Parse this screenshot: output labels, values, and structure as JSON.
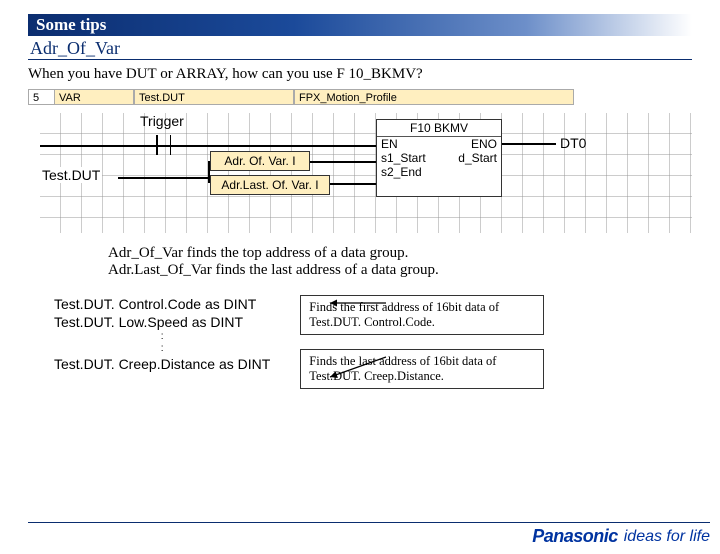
{
  "header": {
    "title": "Some tips",
    "subtitle": "Adr_Of_Var"
  },
  "question": "When you have DUT or ARRAY, how can you use F 10_BKMV?",
  "varrow": {
    "num": "5",
    "class": "VAR",
    "name": "Test.DUT",
    "type": "FPX_Motion_Profile"
  },
  "diagram": {
    "trigger": "Trigger",
    "testdut": "Test.DUT",
    "adr_of_var": "Adr. Of. Var. I",
    "adr_last": "Adr.Last. Of. Var. I",
    "f10_title": "F10 BKMV",
    "en": "EN",
    "eno": "ENO",
    "s1": "s1_Start",
    "d": "d_Start",
    "s2": "s2_End",
    "dt0": "DT0"
  },
  "explain": {
    "line1": "Adr_Of_Var finds the top address of a data group.",
    "line2": "Adr.Last_Of_Var finds the last address of a data group."
  },
  "list": {
    "l1": "Test.DUT. Control.Code as DINT",
    "l2": "Test.DUT. Low.Speed as DINT",
    "l3": "Test.DUT. Creep.Distance as DINT"
  },
  "callout1": "Finds the first address of 16bit data of Test.DUT. Control.Code.",
  "callout2": "Finds the last address of 16bit data of Test.DUT. Creep.Distance.",
  "footer": {
    "brand": "Panasonic",
    "tagline": "ideas for life"
  }
}
